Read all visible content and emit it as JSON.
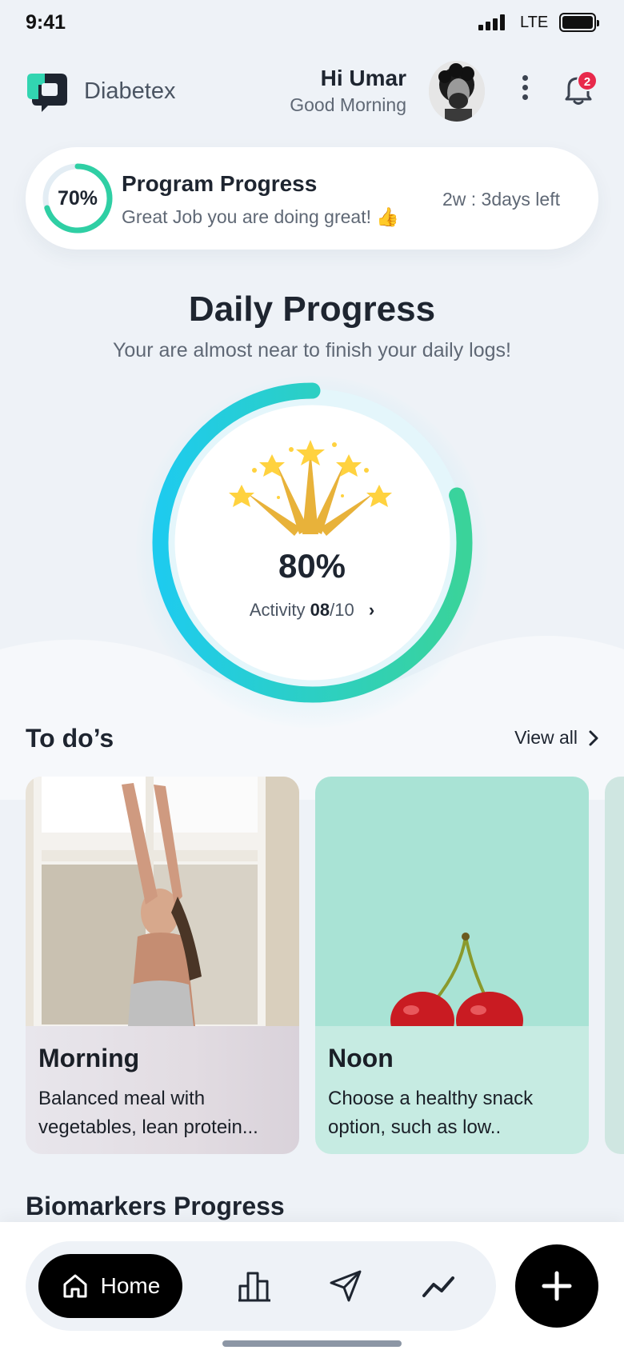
{
  "status_bar": {
    "time": "9:41",
    "network": "LTE"
  },
  "header": {
    "brand": "Diabetex",
    "greeting": "Hi Umar",
    "sub_greeting": "Good Morning",
    "notification_count": "2"
  },
  "program": {
    "percent_label": "70%",
    "percent_value": 0.7,
    "title": "Program Progress",
    "subtitle": "Great Job you are doing great! 👍",
    "time_left": "2w : 3days left"
  },
  "daily": {
    "title": "Daily Progress",
    "subtitle": "Your are almost near to finish your daily logs!",
    "percent_label": "80%",
    "percent_value": 0.8,
    "activity_label": "Activity",
    "activity_done": "08",
    "activity_total": "/10"
  },
  "todos": {
    "title": "To do’s",
    "view_all": "View all",
    "items": [
      {
        "title": "Morning",
        "text_line1": "Balanced meal with",
        "text_line2": "vegetables, lean protein..."
      },
      {
        "title": "Noon",
        "text_line1": "Choose a healthy snack",
        "text_line2": "option, such as low.."
      }
    ]
  },
  "biomarkers": {
    "title": "Biomarkers Progress"
  },
  "nav": {
    "home_label": "Home"
  },
  "colors": {
    "accent_green": "#3dd39a",
    "accent_cyan": "#22c9ea",
    "badge_red": "#e8294b"
  }
}
